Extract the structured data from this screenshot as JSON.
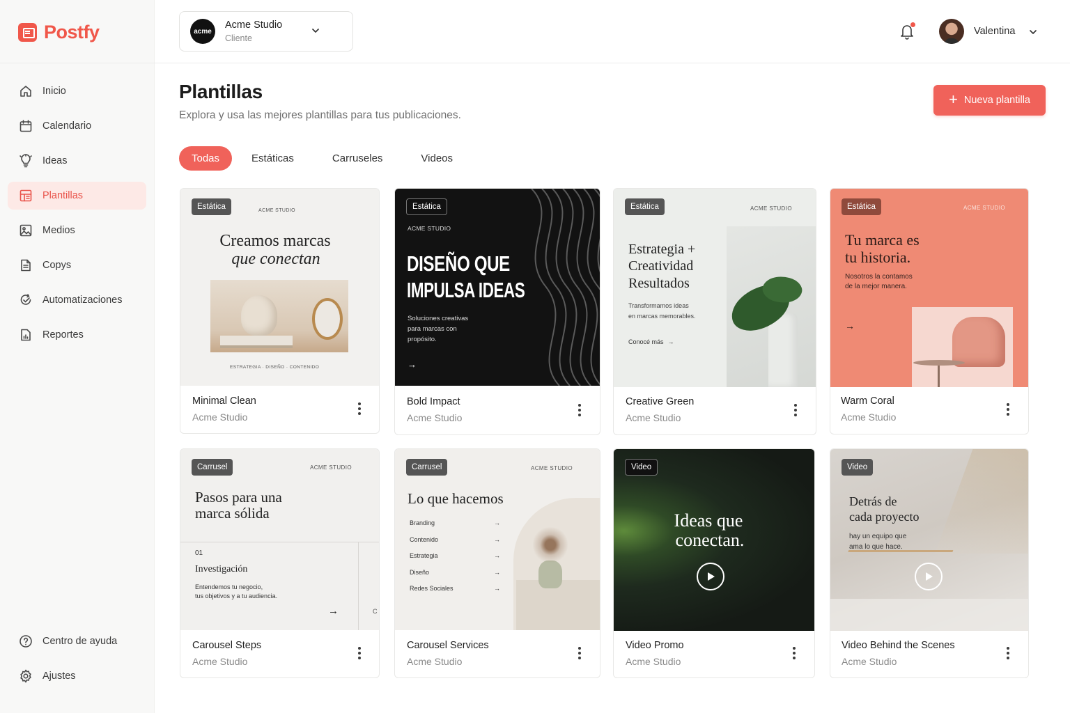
{
  "app": {
    "name": "Postfy",
    "accent": "#f0574a"
  },
  "sidebar": {
    "items": [
      {
        "label": "Inicio",
        "icon": "home-icon"
      },
      {
        "label": "Calendario",
        "icon": "calendar-icon"
      },
      {
        "label": "Ideas",
        "icon": "lightbulb-icon"
      },
      {
        "label": "Plantillas",
        "icon": "template-icon",
        "active": true
      },
      {
        "label": "Medios",
        "icon": "image-icon"
      },
      {
        "label": "Copys",
        "icon": "document-icon"
      },
      {
        "label": "Automatizaciones",
        "icon": "automation-icon"
      },
      {
        "label": "Reportes",
        "icon": "report-icon"
      }
    ],
    "bottom": [
      {
        "label": "Centro de ayuda",
        "icon": "help-icon"
      },
      {
        "label": "Ajustes",
        "icon": "gear-icon"
      }
    ]
  },
  "header": {
    "client": {
      "logo": "acme",
      "name": "Acme Studio",
      "role": "Cliente"
    },
    "user": {
      "name": "Valentina"
    }
  },
  "main": {
    "title": "Plantillas",
    "subtitle": "Explora y usa las mejores plantillas para tus publicaciones.",
    "new_button": "Nueva plantilla",
    "tabs": [
      "Todas",
      "Estáticas",
      "Carruseles",
      "Videos"
    ]
  },
  "cards": [
    {
      "title": "Minimal Clean",
      "client": "Acme Studio",
      "badge": "Estática",
      "art": {
        "brand": "ACME STUDIO",
        "line1": "Creamos marcas",
        "line2": "que conectan",
        "footer": "ESTRATEGIA  ·  DISEÑO  ·  CONTENIDO"
      }
    },
    {
      "title": "Bold Impact",
      "client": "Acme Studio",
      "badge": "Estática",
      "art": {
        "brand": "ACME STUDIO",
        "line1": "DISEÑO QUE",
        "line2": "IMPULSA IDEAS",
        "body1": "Soluciones creativas",
        "body2": "para marcas con",
        "body3": "propósito."
      }
    },
    {
      "title": "Creative Green",
      "client": "Acme Studio",
      "badge": "Estática",
      "art": {
        "brand": "ACME STUDIO",
        "line1": "Estrategia +",
        "line2": "Creatividad",
        "line3": "Resultados",
        "body1": "Transformamos ideas",
        "body2": "en marcas memorables.",
        "link": "Conocé más"
      }
    },
    {
      "title": "Warm Coral",
      "client": "Acme Studio",
      "badge": "Estática",
      "art": {
        "brand": "ACME STUDIO",
        "line1": "Tu marca es",
        "line2": "tu historia.",
        "body1": "Nosotros la contamos",
        "body2": "de la mejor manera."
      }
    },
    {
      "title": "Carousel Steps",
      "client": "Acme Studio",
      "badge": "Carrusel",
      "art": {
        "brand": "ACME STUDIO",
        "line1": "Pasos para una",
        "line2": "marca sólida",
        "num": "01",
        "step": "Investigación",
        "body1": "Entendemos tu negocio,",
        "body2": "tus objetivos y a tu audiencia.",
        "peek": "C"
      }
    },
    {
      "title": "Carousel Services",
      "client": "Acme Studio",
      "badge": "Carrusel",
      "art": {
        "brand": "ACME STUDIO",
        "line1": "Lo que hacemos",
        "services": [
          "Branding",
          "Contenido",
          "Estrategia",
          "Diseño",
          "Redes Sociales"
        ]
      }
    },
    {
      "title": "Video Promo",
      "client": "Acme Studio",
      "badge": "Video",
      "art": {
        "line1": "Ideas que",
        "line2": "conectan."
      }
    },
    {
      "title": "Video Behind the Scenes",
      "client": "Acme Studio",
      "badge": "Video",
      "art": {
        "line1": "Detrás de",
        "line2": "cada proyecto",
        "body1": "hay un equipo que",
        "body2": "ama lo que hace."
      }
    }
  ]
}
